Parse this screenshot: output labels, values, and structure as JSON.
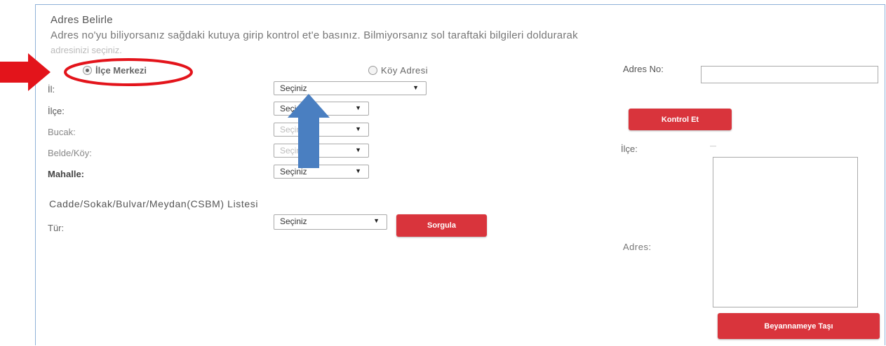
{
  "header": {
    "title": "Adres Belirle",
    "description": "Adres no'yu biliyorsanız sağdaki kutuya girip kontrol et'e basınız. Bilmiyorsanız sol taraftaki bilgileri doldurarak",
    "description_cont": "adresinizi seçiniz."
  },
  "radios": {
    "ilce_merkezi": "İlçe Merkezi",
    "koy_adresi": "Köy Adresi"
  },
  "form": {
    "il_label": "İl:",
    "il_value": "Seçiniz",
    "ilce_label": "İlçe:",
    "ilce_value": "Seçiniz",
    "bucak_label": "Bucak:",
    "bucak_value": "Seçiniz",
    "belde_label": "Belde/Köy:",
    "belde_value": "Seçiniz",
    "mahalle_label": "Mahalle:",
    "mahalle_value": "Seçiniz"
  },
  "csbm": {
    "title": "Cadde/Sokak/Bulvar/Meydan(CSBM) Listesi",
    "tur_label": "Tür:",
    "tur_value": "Seçiniz",
    "sorgula_label": "Sorgula"
  },
  "right": {
    "adres_no_label": "Adres No:",
    "adres_no_value": "",
    "kontrol_label": "Kontrol Et",
    "ilce_label": "İlçe:",
    "ilce_value": "—",
    "adres_label": "Adres:",
    "adres_value": "",
    "beyanname_label": "Beyannameye Taşı"
  },
  "annotations": {
    "red_color": "#e3141b",
    "blue_color": "#4a7fc1"
  }
}
